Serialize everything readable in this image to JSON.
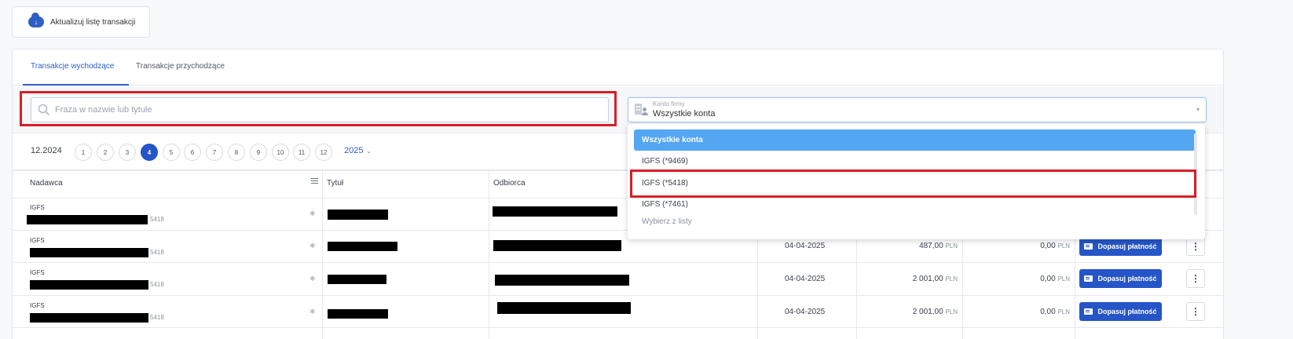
{
  "toolbar": {
    "update_label": "Aktualizuj listę transakcji"
  },
  "tabs": [
    {
      "label": "Transakcje wychodzące",
      "active": true
    },
    {
      "label": "Transakcje przychodzące",
      "active": false
    }
  ],
  "search": {
    "placeholder": "Fraza w nazwie lub tytule",
    "value": ""
  },
  "account_filter": {
    "label": "Konto firmy",
    "value": "Wszystkie konta",
    "options": [
      "Wszystkie konta",
      "IGFS (*9469)",
      "IGFS (*5418)",
      "IGFS (*7461)"
    ],
    "hint": "Wybierz z listy"
  },
  "period": {
    "current": "12.2024",
    "months": [
      "1",
      "2",
      "3",
      "4",
      "5",
      "6",
      "7",
      "8",
      "9",
      "10",
      "11",
      "12"
    ],
    "active_month": "4",
    "year": "2025"
  },
  "table": {
    "columns": [
      "Nadawca",
      "Tytuł",
      "Odbiorca"
    ],
    "rows": [
      {
        "sender": "IGFS",
        "account": "5418",
        "date": "",
        "amount": "",
        "amount_cur": "",
        "paid": "",
        "paid_cur": "",
        "action": ""
      },
      {
        "sender": "IGFS",
        "account": "5418",
        "date": "04-04-2025",
        "amount": "487,00",
        "amount_cur": "PLN",
        "paid": "0,00",
        "paid_cur": "PLN",
        "action": "Dopasuj płatność"
      },
      {
        "sender": "IGFS",
        "account": "5418",
        "date": "04-04-2025",
        "amount": "2 001,00",
        "amount_cur": "PLN",
        "paid": "0,00",
        "paid_cur": "PLN",
        "action": "Dopasuj płatność"
      },
      {
        "sender": "IGFS",
        "account": "5418",
        "date": "04-04-2025",
        "amount": "2 001,00",
        "amount_cur": "PLN",
        "paid": "0,00",
        "paid_cur": "PLN",
        "action": "Dopasuj płatność"
      }
    ],
    "more_label": "⋮"
  },
  "colors": {
    "accent": "#2555c7",
    "highlight": "#d81e28",
    "selected_option": "#53a6f2"
  }
}
